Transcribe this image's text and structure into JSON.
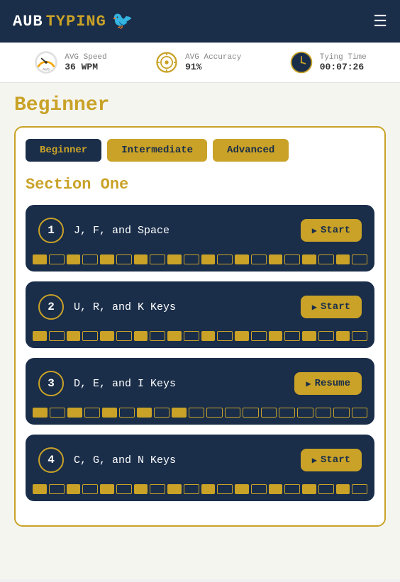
{
  "header": {
    "logo_aub": "AUB",
    "logo_typing": "TYPING",
    "menu_label": "☰"
  },
  "stats": {
    "speed_label": "AVG Speed",
    "speed_value": "36 WPM",
    "accuracy_label": "AVG Accuracy",
    "accuracy_value": "91%",
    "time_label": "Tying Time",
    "time_value": "00:07:26"
  },
  "page": {
    "title": "Beginner"
  },
  "tabs": [
    {
      "label": "Beginner",
      "active": true
    },
    {
      "label": "Intermediate",
      "active": false
    },
    {
      "label": "Advanced",
      "active": false
    }
  ],
  "section": {
    "title": "Section One"
  },
  "lessons": [
    {
      "number": "1",
      "name": "J, F, and Space",
      "btn_label": "Start",
      "btn_type": "start"
    },
    {
      "number": "2",
      "name": "U, R, and K Keys",
      "btn_label": "Start",
      "btn_type": "start"
    },
    {
      "number": "3",
      "name": "D, E, and I Keys",
      "btn_label": "Resume",
      "btn_type": "resume"
    },
    {
      "number": "4",
      "name": "C, G, and N Keys",
      "btn_label": "Start",
      "btn_type": "start"
    }
  ]
}
